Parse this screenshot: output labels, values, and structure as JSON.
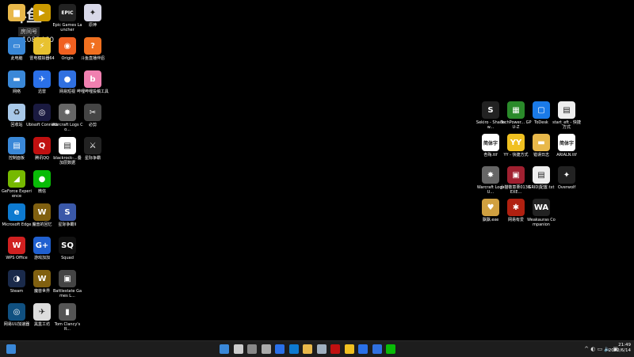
{
  "watermark": {
    "logo": "斗鱼",
    "room": "房间号",
    "id": "1082460"
  },
  "left_icons": [
    {
      "label": "",
      "color": "#e8b84a",
      "glyph": "▆"
    },
    {
      "label": "",
      "color": "#cc9a00",
      "glyph": "▶"
    },
    {
      "label": "Epic Games Launcher",
      "color": "#222",
      "glyph": "EPIC"
    },
    {
      "label": "原神",
      "color": "#d8d8e8",
      "glyph": "✦"
    },
    {
      "label": "此电脑",
      "color": "#3a88d8",
      "glyph": "▭"
    },
    {
      "label": "雷电模拟器64",
      "color": "#e8c230",
      "glyph": "⚡"
    },
    {
      "label": "Origin",
      "color": "#f06020",
      "glyph": "◉"
    },
    {
      "label": "斗鱼直播伴侣",
      "color": "#f07020",
      "glyph": "?"
    },
    {
      "label": "网络",
      "color": "#3a88d8",
      "glyph": "▬"
    },
    {
      "label": "迅雷",
      "color": "#2a70e8",
      "glyph": "✈"
    },
    {
      "label": "网易短视",
      "color": "#3070e0",
      "glyph": "●"
    },
    {
      "label": "哔哩哔哩投稿工具",
      "color": "#f080b0",
      "glyph": "b"
    },
    {
      "label": "回收站",
      "color": "#a8c8e8",
      "glyph": "♻"
    },
    {
      "label": "Ubisoft Connect",
      "color": "#1a1a40",
      "glyph": "◎"
    },
    {
      "label": "Warcraft Logs Co...",
      "color": "#666",
      "glyph": "✸"
    },
    {
      "label": "必剪",
      "color": "#444",
      "glyph": "✂"
    },
    {
      "label": "控制面板",
      "color": "#3a88d8",
      "glyph": "▤"
    },
    {
      "label": "腾讯QQ",
      "color": "#c01010",
      "glyph": "Q"
    },
    {
      "label": "blackrock-...叠加层数据",
      "color": "#fff",
      "glyph": "▤"
    },
    {
      "label": "星际争霸",
      "color": "#222",
      "glyph": "⚔"
    },
    {
      "label": "GeForce Experience",
      "color": "#76b900",
      "glyph": "◢"
    },
    {
      "label": "微信",
      "color": "#09bb07",
      "glyph": "●"
    },
    {
      "label": "",
      "color": "#000",
      "glyph": ""
    },
    {
      "label": "",
      "color": "#000",
      "glyph": ""
    },
    {
      "label": "Microsoft Edge",
      "color": "#0d7ad0",
      "glyph": "e"
    },
    {
      "label": "魔兽的回忆",
      "color": "#806010",
      "glyph": "W"
    },
    {
      "label": "星际争霸II",
      "color": "#3a58a8",
      "glyph": "S"
    },
    {
      "label": "",
      "color": "#000",
      "glyph": ""
    },
    {
      "label": "WPS Office",
      "color": "#d02020",
      "glyph": "W"
    },
    {
      "label": "游戏加加",
      "color": "#2060d0",
      "glyph": "G+"
    },
    {
      "label": "Squad",
      "color": "#111",
      "glyph": "SQ"
    },
    {
      "label": "",
      "color": "#000",
      "glyph": ""
    },
    {
      "label": "Steam",
      "color": "#1a2a4a",
      "glyph": "◑"
    },
    {
      "label": "魔兽世界",
      "color": "#806010",
      "glyph": "W"
    },
    {
      "label": "Battlestate Games L...",
      "color": "#444",
      "glyph": "▣"
    },
    {
      "label": "",
      "color": "#000",
      "glyph": ""
    },
    {
      "label": "网易UU加速器",
      "color": "#105080",
      "glyph": "◎"
    },
    {
      "label": "黑盒工坊",
      "color": "#ddd",
      "glyph": "✈"
    },
    {
      "label": "Tom Clancy's R...",
      "color": "#555",
      "glyph": "▮"
    }
  ],
  "right_icons": [
    {
      "label": "Sekiro - Shadow...",
      "color": "#222",
      "glyph": "S"
    },
    {
      "label": "TechPower... GPU-Z",
      "color": "#2a8a2a",
      "glyph": "▦"
    },
    {
      "label": "ToDesk",
      "color": "#1a7ae8",
      "glyph": "▢"
    },
    {
      "label": "start_eft - 快捷方式",
      "color": "#eee",
      "glyph": "▤"
    },
    {
      "label": "杏殇.ttf",
      "color": "#fff",
      "glyph": "简体字"
    },
    {
      "label": "YY - 快捷方式",
      "color": "#f0c020",
      "glyph": "YY"
    },
    {
      "label": "错误日志",
      "color": "#e8b84a",
      "glyph": "▬"
    },
    {
      "label": "ARIALN.ttf",
      "color": "#fff",
      "glyph": "简体字"
    },
    {
      "label": "Warcraft Logs U...",
      "color": "#666",
      "glyph": "✸"
    },
    {
      "label": "小猫敬意栗0130.EXE...",
      "color": "#a02030",
      "glyph": "▣"
    },
    {
      "label": "GRID|配置.txt",
      "color": "#eee",
      "glyph": "▤"
    },
    {
      "label": "Overwolf",
      "color": "#222",
      "glyph": "✦"
    },
    {
      "label": "飘飘.exe",
      "color": "#d0a040",
      "glyph": "♥"
    },
    {
      "label": "网易有爱",
      "color": "#b02010",
      "glyph": "✱"
    },
    {
      "label": "Weakauras Companion",
      "color": "#222",
      "glyph": "WA"
    }
  ],
  "taskbar": {
    "icons": [
      "#3a88d8",
      "#ccc",
      "#888",
      "#aaa",
      "#2a70e8",
      "#0d7ad0",
      "#e8b84a",
      "#a0b0c0",
      "#c01010",
      "#f0c020",
      "#2a70e8",
      "#3070e0",
      "#09bb07"
    ],
    "tray": "^ ◐ ▭ 🔈 ▣",
    "time": "21:49",
    "date": "2022/6/14"
  }
}
